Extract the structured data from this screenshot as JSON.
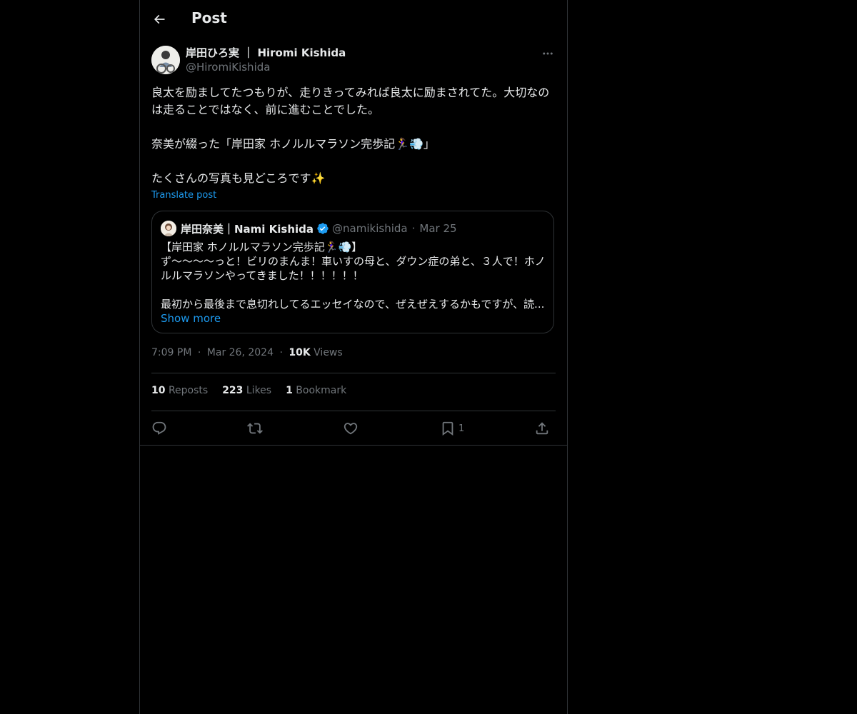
{
  "header": {
    "title": "Post",
    "back_icon": "arrow-left-icon"
  },
  "author": {
    "display_name": "岸田ひろ実 ｜ Hiromi Kishida",
    "handle": "@HiromiKishida"
  },
  "post": {
    "text": "良太を励ましてたつもりが、走りきってみれば良太に励まされてた。大切なのは走ることではなく、前に進むことでした。\n\n奈美が綴った「岸田家 ホノルルマラソン完歩記🏃‍♀️💨」\n\nたくさんの写真も見どころです✨",
    "translate_label": "Translate post"
  },
  "quote": {
    "display_name": "岸田奈美｜Nami Kishida",
    "handle": "@namikishida",
    "separator": "·",
    "date": "Mar 25",
    "lines": [
      "【岸田家 ホノルルマラソン完歩記🏃‍♀️💨】",
      "ず〜〜〜〜っと！ビリのまんま！車いすの母と、ダウン症の弟と、３人で！ホノルルマラソンやってきました！！！！！！",
      "最初から最後まで息切れしてるエッセイなので、ぜえぜえするかもですが、読..."
    ],
    "show_more": "Show more"
  },
  "meta": {
    "time": "7:09 PM",
    "separator": "·",
    "date": "Mar 26, 2024",
    "views_count": "10K",
    "views_label": "Views"
  },
  "stats": {
    "reposts_count": "10",
    "reposts_label": "Reposts",
    "likes_count": "223",
    "likes_label": "Likes",
    "bookmarks_count": "1",
    "bookmarks_label": "Bookmark"
  },
  "actions": {
    "reply_icon": "reply-icon",
    "repost_icon": "repost-icon",
    "like_icon": "like-icon",
    "bookmark_icon": "bookmark-icon",
    "bookmark_count": "1",
    "share_icon": "share-icon"
  },
  "colors": {
    "background": "#000000",
    "text": "#e7e9ea",
    "secondary": "#71767b",
    "accent": "#1d9bf0",
    "border": "#2f3336"
  }
}
